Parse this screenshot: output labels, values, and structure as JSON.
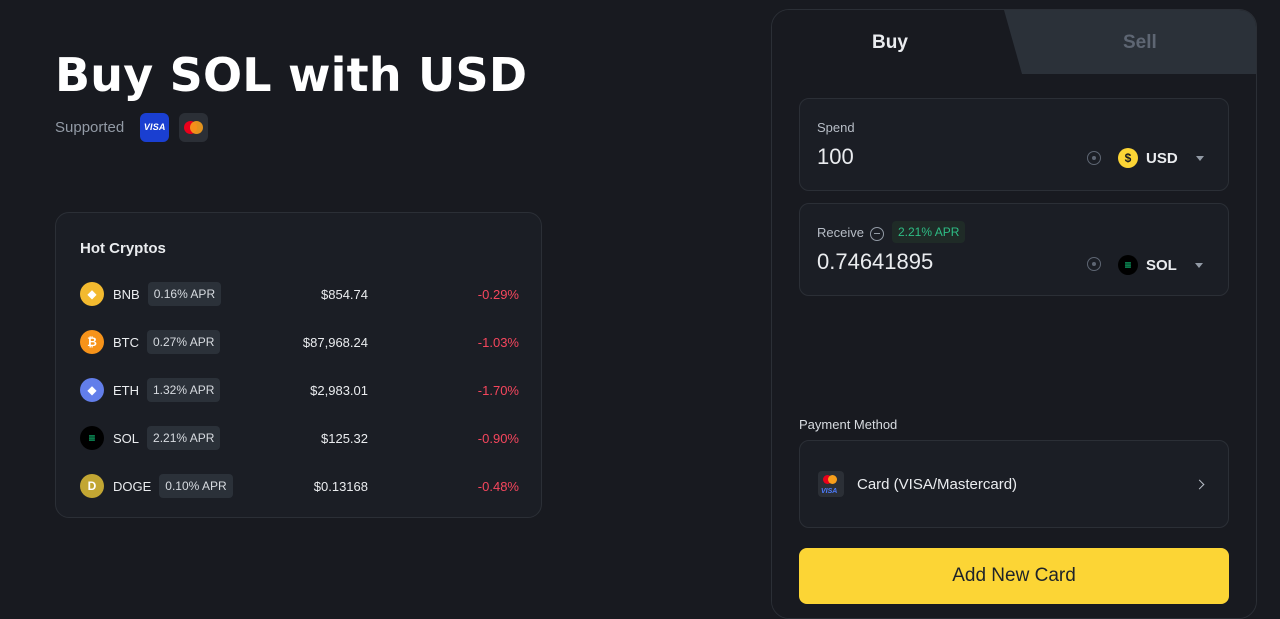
{
  "header": {
    "title": "Buy SOL with USD",
    "supported_label": "Supported",
    "visa_text": "VISA"
  },
  "hot": {
    "title": "Hot Cryptos",
    "coins": [
      {
        "symbol": "BNB",
        "apr": "0.16% APR",
        "price": "$854.74",
        "change": "-0.29%",
        "color": "#f3ba2f",
        "glyph": "◆"
      },
      {
        "symbol": "BTC",
        "apr": "0.27% APR",
        "price": "$87,968.24",
        "change": "-1.03%",
        "color": "#f7931a",
        "glyph": "₿"
      },
      {
        "symbol": "ETH",
        "apr": "1.32% APR",
        "price": "$2,983.01",
        "change": "-1.70%",
        "color": "#627eea",
        "glyph": "◆"
      },
      {
        "symbol": "SOL",
        "apr": "2.21% APR",
        "price": "$125.32",
        "change": "-0.90%",
        "color": "#000000",
        "glyph": "≡"
      },
      {
        "symbol": "DOGE",
        "apr": "0.10% APR",
        "price": "$0.13168",
        "change": "-0.48%",
        "color": "#c2a633",
        "glyph": "D"
      }
    ]
  },
  "trade": {
    "tabs": {
      "buy": "Buy",
      "sell": "Sell"
    },
    "spend": {
      "label": "Spend",
      "value": "100",
      "currency": "USD",
      "currency_glyph": "$"
    },
    "receive": {
      "label": "Receive",
      "apr": "2.21% APR",
      "value": "0.74641895",
      "currency": "SOL",
      "currency_glyph": "≡"
    },
    "payment_label": "Payment Method",
    "payment_method": "Card (VISA/Mastercard)",
    "card_icon_text": "VISA",
    "add_card": "Add New Card"
  },
  "colors": {
    "accent": "#fcd535",
    "negative": "#f6465d",
    "positive": "#2ebd85"
  }
}
